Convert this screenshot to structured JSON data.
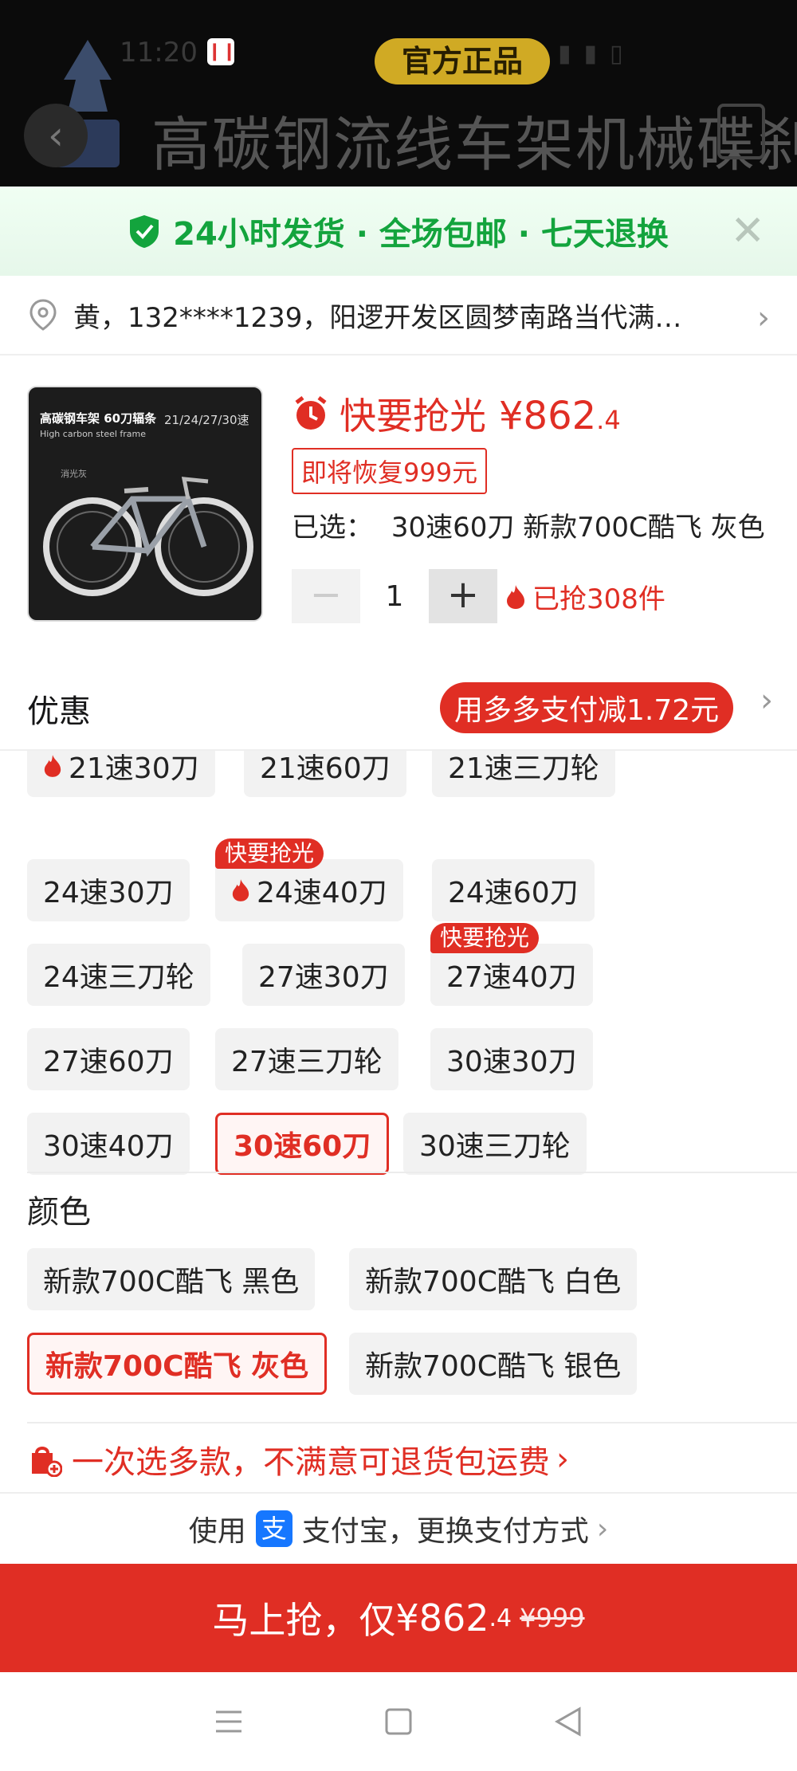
{
  "status_bar": {
    "time": "11:20"
  },
  "header": {
    "official_badge": "官方正品",
    "banner_text": "高碳钢流线车架机械碟刹"
  },
  "promo_bar": {
    "text": "24小时发货 · 全场包邮 · 七天退换",
    "close_icon": "close-icon"
  },
  "address": {
    "text": "黄，132****1239，阳逻开发区圆梦南路当代满…"
  },
  "product": {
    "image_text": {
      "title": "高碳钢车架 60刀辐条",
      "subtitle": "High carbon steel frame",
      "speeds": "21/24/27/30速",
      "color_note": "消光灰"
    },
    "hurry_label": "快要抢光",
    "price_main": "¥862",
    "price_decimal": ".4",
    "restore_label": "即将恢复999元",
    "selected_label": "已选：",
    "selected_value": "30速60刀 新款700C酷飞 灰色",
    "quantity": "1",
    "minus": "−",
    "plus": "+",
    "grabbed": "已抢308件"
  },
  "discount": {
    "label": "优惠",
    "pill": "用多多支付减1.72元"
  },
  "specs": {
    "items": [
      {
        "label": "21速30刀",
        "flame": true
      },
      {
        "label": "21速60刀"
      },
      {
        "label": "21速三刀轮"
      },
      {
        "label": "24速30刀"
      },
      {
        "label": "24速40刀",
        "flame": true,
        "tag": "快要抢光"
      },
      {
        "label": "24速60刀"
      },
      {
        "label": "24速三刀轮"
      },
      {
        "label": "27速30刀"
      },
      {
        "label": "27速40刀",
        "tag": "快要抢光"
      },
      {
        "label": "27速60刀"
      },
      {
        "label": "27速三刀轮"
      },
      {
        "label": "30速30刀"
      },
      {
        "label": "30速40刀"
      },
      {
        "label": "30速60刀",
        "selected": true
      },
      {
        "label": "30速三刀轮"
      }
    ]
  },
  "color_section": {
    "title": "颜色",
    "items": [
      {
        "label": "新款700C酷飞 黑色"
      },
      {
        "label": "新款700C酷飞 白色"
      },
      {
        "label": "新款700C酷飞 灰色",
        "selected": true
      },
      {
        "label": "新款700C酷飞 银色"
      }
    ]
  },
  "returns": {
    "text": "一次选多款，不满意可退货包运费"
  },
  "payment": {
    "prefix": "使用",
    "ali_glyph": "支",
    "text": "支付宝，更换支付方式"
  },
  "buy_button": {
    "label": "马上抢，仅 ",
    "price": "¥862",
    "decimal": ".4",
    "original": "¥999"
  },
  "colors": {
    "accent": "#e02e24",
    "green": "#13a43d",
    "alipay": "#1677ff"
  }
}
